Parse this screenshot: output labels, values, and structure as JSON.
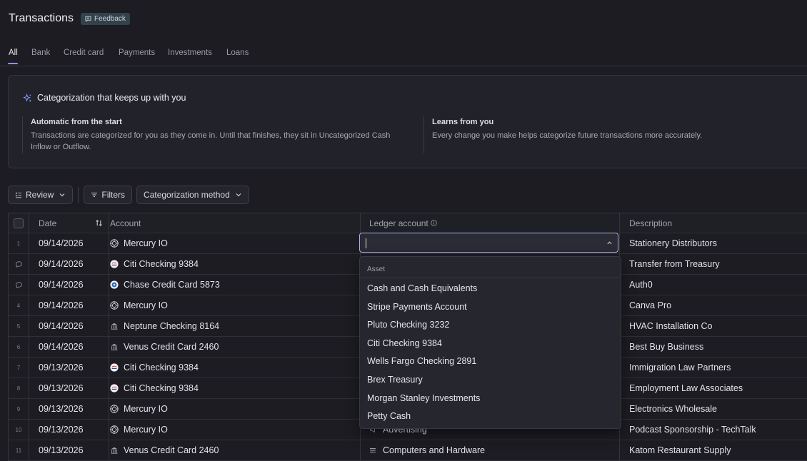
{
  "header": {
    "title": "Transactions",
    "feedback_label": "Feedback"
  },
  "tabs": [
    {
      "label": "All",
      "active": true
    },
    {
      "label": "Bank"
    },
    {
      "label": "Credit card"
    },
    {
      "label": "Payments"
    },
    {
      "label": "Investments"
    },
    {
      "label": "Loans"
    }
  ],
  "info_card": {
    "title": "Categorization that keeps up with you",
    "col1_heading": "Automatic from the start",
    "col1_body_line1": "Transactions are categorized for you as they come in. Until that finishes, they sit in Uncategorized Cash",
    "col1_body_line2": "Inflow or Outflow.",
    "col2_heading": "Learns from you",
    "col2_body": "Every change you make helps categorize future transactions more accurately."
  },
  "toolbar": {
    "review_label": "Review",
    "filters_label": "Filters",
    "categorization_label": "Categorization method"
  },
  "table": {
    "headers": {
      "date": "Date",
      "account": "Account",
      "ledger": "Ledger account",
      "description": "Description"
    },
    "rows": [
      {
        "marker": "1",
        "date": "09/14/2026",
        "account": "Mercury IO",
        "account_icon": "mercury-icon",
        "ledger": "",
        "description": "Stationery Distributors"
      },
      {
        "marker": "comment",
        "date": "09/14/2026",
        "account": "Citi Checking 9384",
        "account_icon": "citi-icon",
        "ledger": "",
        "description": "Transfer from Treasury"
      },
      {
        "marker": "comment",
        "date": "09/14/2026",
        "account": "Chase Credit Card 5873",
        "account_icon": "chase-icon",
        "ledger": "",
        "description": "Auth0"
      },
      {
        "marker": "4",
        "date": "09/14/2026",
        "account": "Mercury IO",
        "account_icon": "mercury-icon",
        "ledger": "",
        "description": "Canva Pro"
      },
      {
        "marker": "5",
        "date": "09/14/2026",
        "account": "Neptune Checking 8164",
        "account_icon": "bank-icon",
        "ledger": "",
        "description": "HVAC Installation Co"
      },
      {
        "marker": "6",
        "date": "09/14/2026",
        "account": "Venus Credit Card 2460",
        "account_icon": "bank-icon",
        "ledger": "",
        "description": "Best Buy Business"
      },
      {
        "marker": "7",
        "date": "09/13/2026",
        "account": "Citi Checking 9384",
        "account_icon": "citi-icon",
        "ledger": "",
        "description": "Immigration Law Partners"
      },
      {
        "marker": "8",
        "date": "09/13/2026",
        "account": "Citi Checking 9384",
        "account_icon": "citi-icon",
        "ledger": "",
        "description": "Employment Law Associates"
      },
      {
        "marker": "9",
        "date": "09/13/2026",
        "account": "Mercury IO",
        "account_icon": "mercury-icon",
        "ledger": "",
        "description": "Electronics Wholesale"
      },
      {
        "marker": "10",
        "date": "09/13/2026",
        "account": "Mercury IO",
        "account_icon": "mercury-icon",
        "ledger": "Advertising",
        "description": "Podcast Sponsorship - TechTalk"
      },
      {
        "marker": "11",
        "date": "09/13/2026",
        "account": "Venus Credit Card 2460",
        "account_icon": "bank-icon",
        "ledger": "Computers and Hardware",
        "description": "Katom Restaurant Supply"
      }
    ]
  },
  "ledger_dropdown": {
    "input_value": "",
    "group_label": "Asset",
    "options": [
      "Cash and Cash Equivalents",
      "Stripe Payments Account",
      "Pluto Checking 3232",
      "Citi Checking 9384",
      "Wells Fargo Checking 2891",
      "Brex Treasury",
      "Morgan Stanley Investments",
      "Petty Cash"
    ]
  }
}
